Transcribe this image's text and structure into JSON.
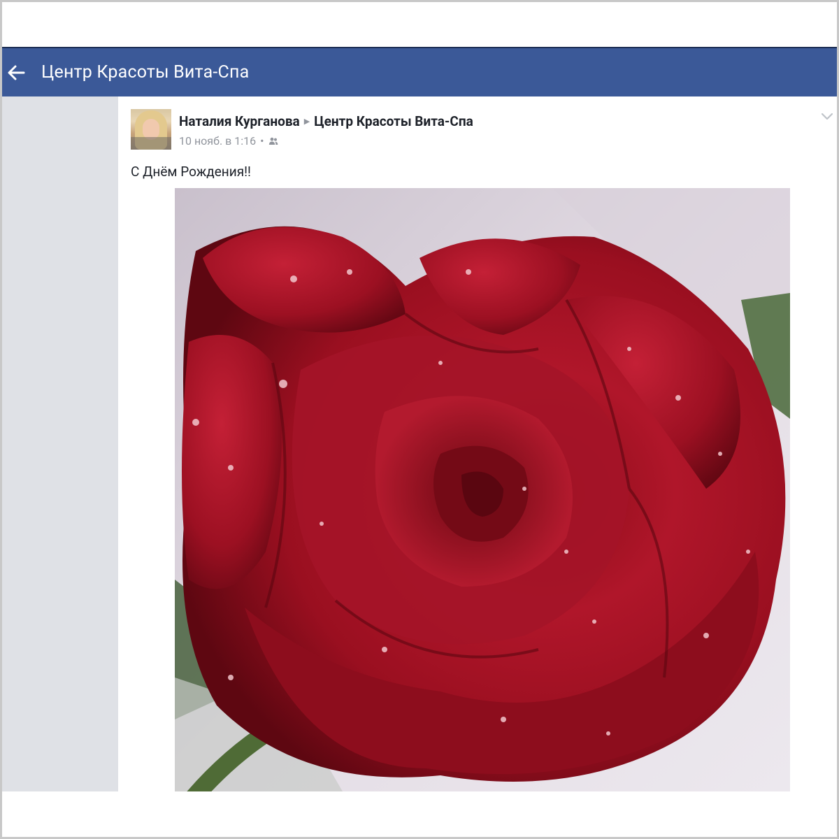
{
  "header": {
    "title": "Центр Красоты Вита-Спа"
  },
  "post": {
    "author": "Наталия Курганова",
    "target": "Центр Красоты Вита-Спа",
    "timestamp": "10 нояб. в 1:16",
    "privacy_icon": "friends-icon",
    "text": "С Днём Рождения!!"
  },
  "colors": {
    "header_bg": "#3b5998",
    "gutter_bg": "#dfe1e6",
    "meta_text": "#90949c",
    "rose_red": "#a0101e"
  }
}
